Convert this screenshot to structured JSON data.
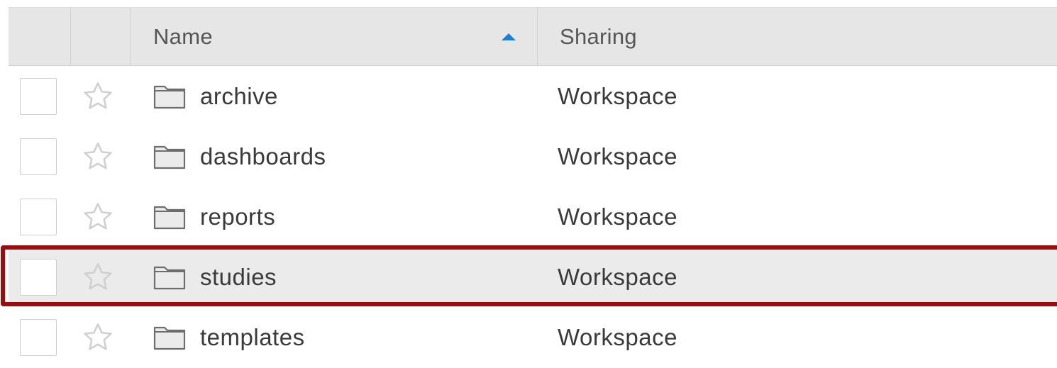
{
  "table": {
    "columns": {
      "name": "Name",
      "sharing": "Sharing"
    },
    "sort": {
      "column": "name",
      "direction": "ascending"
    },
    "rows": [
      {
        "name": "archive",
        "sharing": "Workspace",
        "starred": false,
        "checked": false
      },
      {
        "name": "dashboards",
        "sharing": "Workspace",
        "starred": false,
        "checked": false
      },
      {
        "name": "reports",
        "sharing": "Workspace",
        "starred": false,
        "checked": false
      },
      {
        "name": "studies",
        "sharing": "Workspace",
        "starred": false,
        "checked": false
      },
      {
        "name": "templates",
        "sharing": "Workspace",
        "starred": false,
        "checked": false
      }
    ]
  },
  "icons": {
    "row_icon": "folder-icon",
    "favorite_icon": "star-outline-icon",
    "sort_icon": "sort-ascending-icon"
  },
  "colors": {
    "header_bg": "#e6e6e6",
    "sort_accent": "#1b7fd6",
    "highlight_border": "#9b0c0c",
    "highlight_row_bg": "#ebebeb"
  }
}
